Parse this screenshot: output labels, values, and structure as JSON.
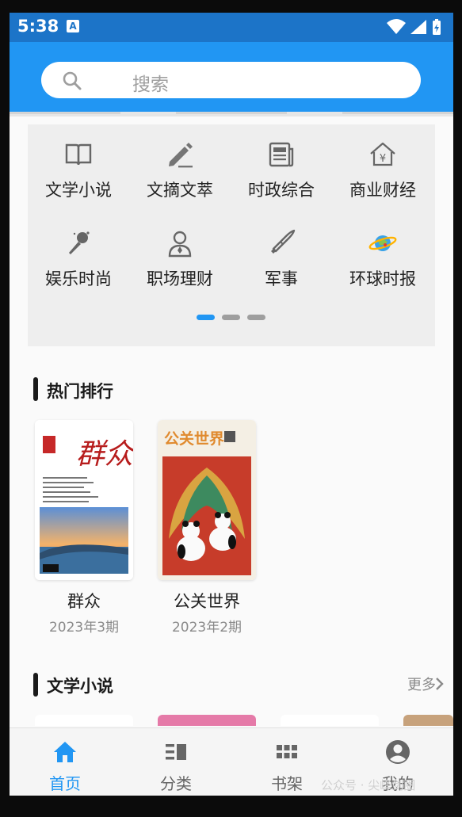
{
  "status": {
    "time": "5:38",
    "app_badge": "A"
  },
  "search": {
    "placeholder": "搜索"
  },
  "categories": [
    {
      "label": "文学小说",
      "icon": "book-open-icon"
    },
    {
      "label": "文摘文萃",
      "icon": "pencil-icon"
    },
    {
      "label": "时政综合",
      "icon": "newspaper-icon"
    },
    {
      "label": "商业财经",
      "icon": "yuan-house-icon"
    },
    {
      "label": "娱乐时尚",
      "icon": "microphone-icon"
    },
    {
      "label": "职场理财",
      "icon": "person-tie-icon"
    },
    {
      "label": "军事",
      "icon": "bullet-icon"
    },
    {
      "label": "环球时报",
      "icon": "planet-icon"
    }
  ],
  "pager": {
    "pages": 3,
    "active": 0
  },
  "hot": {
    "title": "热门排行",
    "books": [
      {
        "name": "群众",
        "issue": "2023年3期",
        "cover_text": "群众"
      },
      {
        "name": "公关世界",
        "issue": "2023年2期",
        "cover_text": "公关世界"
      }
    ]
  },
  "literature": {
    "title": "文学小说",
    "more": "更多"
  },
  "nav": [
    {
      "label": "首页",
      "icon": "home-icon",
      "active": true
    },
    {
      "label": "分类",
      "icon": "category-icon",
      "active": false
    },
    {
      "label": "书架",
      "icon": "bookshelf-grid-icon",
      "active": false
    },
    {
      "label": "我的",
      "icon": "account-circle-icon",
      "active": false
    }
  ],
  "watermark": "公众号 · 尖峰剑圈",
  "colors": {
    "primary": "#2196f3",
    "statusbar": "#1c74c8"
  }
}
